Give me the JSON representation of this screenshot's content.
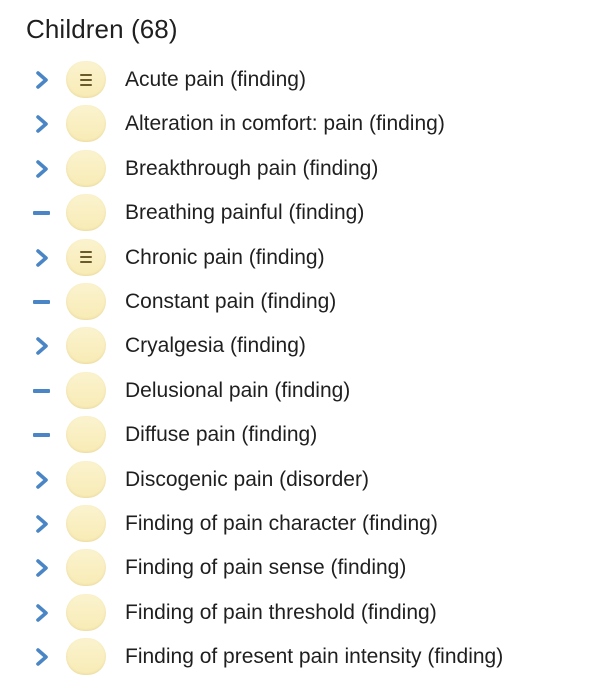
{
  "heading": "Children (68)",
  "colors": {
    "toggle_blue": "#4a86c5",
    "pill_fill": "#f9eec0",
    "text": "#1f1f1f"
  },
  "children": [
    {
      "label": "Acute pain (finding)",
      "toggle": "chevron-right-icon",
      "defined": true
    },
    {
      "label": "Alteration in comfort: pain (finding)",
      "toggle": "chevron-right-icon",
      "defined": false
    },
    {
      "label": "Breakthrough pain (finding)",
      "toggle": "chevron-right-icon",
      "defined": false
    },
    {
      "label": "Breathing painful (finding)",
      "toggle": "dash-icon",
      "defined": false
    },
    {
      "label": "Chronic pain (finding)",
      "toggle": "chevron-right-icon",
      "defined": true
    },
    {
      "label": "Constant pain (finding)",
      "toggle": "dash-icon",
      "defined": false
    },
    {
      "label": "Cryalgesia (finding)",
      "toggle": "chevron-right-icon",
      "defined": false
    },
    {
      "label": "Delusional pain (finding)",
      "toggle": "dash-icon",
      "defined": false
    },
    {
      "label": "Diffuse pain (finding)",
      "toggle": "dash-icon",
      "defined": false
    },
    {
      "label": "Discogenic pain (disorder)",
      "toggle": "chevron-right-icon",
      "defined": false
    },
    {
      "label": "Finding of pain character (finding)",
      "toggle": "chevron-right-icon",
      "defined": false
    },
    {
      "label": "Finding of pain sense (finding)",
      "toggle": "chevron-right-icon",
      "defined": false
    },
    {
      "label": "Finding of pain threshold (finding)",
      "toggle": "chevron-right-icon",
      "defined": false
    },
    {
      "label": "Finding of present pain intensity (finding)",
      "toggle": "chevron-right-icon",
      "defined": false
    }
  ]
}
